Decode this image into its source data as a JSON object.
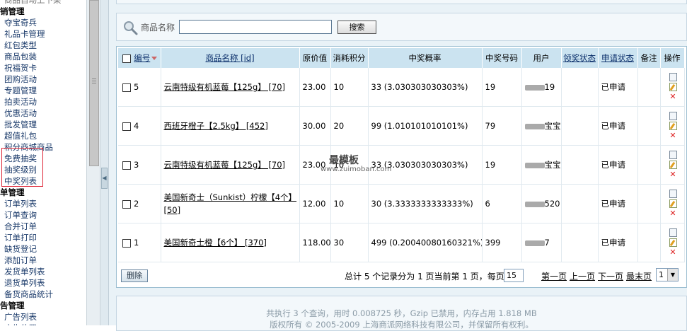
{
  "sidebar": {
    "top_cut": "商品自动上下架",
    "groups": [
      {
        "title": "促销管理",
        "items": [
          "夺宝奇兵",
          "礼品卡管理",
          "红包类型",
          "商品包装",
          "祝福贺卡",
          "团购活动",
          "专题管理",
          "拍卖活动",
          "优惠活动",
          "批发管理",
          "超值礼包",
          "积分商城商品",
          "免费抽奖",
          "抽奖级别",
          "中奖列表"
        ]
      },
      {
        "title": "订单管理",
        "items": [
          "订单列表",
          "订单查询",
          "合并订单",
          "订单打印",
          "缺货登记",
          "添加订单",
          "发货单列表",
          "退货单列表",
          "备货商品统计"
        ]
      },
      {
        "title": "广告管理",
        "items": [
          "广告列表",
          "广告位置"
        ]
      }
    ],
    "group_labels": [
      "销管理",
      "单管理",
      "告管理"
    ],
    "highlight_color": "#dd2233"
  },
  "search": {
    "label": "商品名称",
    "value": "",
    "button": "搜索"
  },
  "table": {
    "headers": [
      "编号",
      "商品名称 [id]",
      "原价值",
      "消耗积分",
      "中奖概率",
      "中奖号码",
      "用户",
      "领奖状态",
      "申请状态",
      "备注",
      "操作"
    ],
    "rows": [
      {
        "id": "5",
        "name": "云南特级有机蓝莓【125g】 [70]",
        "price": "23.00",
        "points": "10",
        "rate": "33  (3.030303030303%)",
        "winning_no": "19",
        "user": "19",
        "claim": "",
        "apply": "已申请",
        "note": ""
      },
      {
        "id": "4",
        "name": "西班牙橙子【2.5kg】 [452]",
        "price": "30.00",
        "points": "20",
        "rate": "99  (1.010101010101%)",
        "winning_no": "79",
        "user": "宝宝",
        "claim": "",
        "apply": "已申请",
        "note": ""
      },
      {
        "id": "3",
        "name": "云南特级有机蓝莓【125g】 [70]",
        "price": "23.00",
        "points": "10",
        "rate": "33  (3.030303030303%)",
        "winning_no": "19",
        "user": "宝宝",
        "claim": "",
        "apply": "已申请",
        "note": ""
      },
      {
        "id": "2",
        "name": "美国新奇士（Sunkist）柠檬【4个】 [50]",
        "price": "12.00",
        "points": "10",
        "rate": "30  (3.3333333333333%)",
        "winning_no": "6",
        "user": "520",
        "claim": "",
        "apply": "已申请",
        "note": ""
      },
      {
        "id": "1",
        "name": "美国新奇士橙【6个】 [370]",
        "price": "118.00",
        "points": "30",
        "rate": "499  (0.20040080160321%)",
        "winning_no": "399",
        "user": "7",
        "claim": "",
        "apply": "已申请",
        "note": ""
      }
    ]
  },
  "pager": {
    "delete": "删除",
    "summary": "总计 5 个记录分为 1 页当前第 1 页，每页",
    "page_size": "15",
    "first": "第一页",
    "prev": "上一页",
    "next": "下一页",
    "last": "最末页",
    "current": "1"
  },
  "watermark": {
    "line1": "最模板",
    "line2": "www.zuimoban.com"
  },
  "footer": {
    "line1": "共执行 3 个查询，用时 0.008725 秒，Gzip 已禁用，内存占用 1.818 MB",
    "line2": "版权所有 © 2005-2009 上海商派网络科技有限公司，并保留所有权利。"
  }
}
